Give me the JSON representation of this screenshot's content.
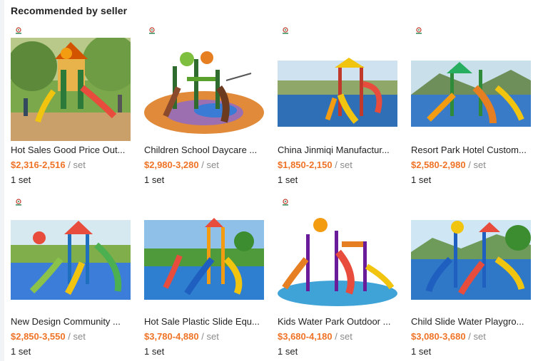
{
  "section": {
    "title": "Recommended by seller"
  },
  "colors": {
    "price": "#ef7326",
    "unit": "#8a8a8a"
  },
  "products": [
    {
      "title": "Hot Sales Good Price Out...",
      "price": "$2,316-2,516",
      "unit": "/ set",
      "moq": "1 set",
      "logo": "supplier-logo-icon",
      "image": "playground-image"
    },
    {
      "title": "Children School Daycare ...",
      "price": "$2,980-3,280",
      "unit": "/ set",
      "moq": "1 set",
      "logo": "supplier-logo-icon",
      "image": "playground-image"
    },
    {
      "title": "China Jinmiqi Manufactur...",
      "price": "$1,850-2,150",
      "unit": "/ set",
      "moq": "1 set",
      "logo": "supplier-logo-icon",
      "image": "playground-image"
    },
    {
      "title": "Resort Park Hotel Custom...",
      "price": "$2,580-2,980",
      "unit": "/ set",
      "moq": "1 set",
      "logo": "supplier-logo-icon",
      "image": "playground-image"
    },
    {
      "title": "New Design Community ...",
      "price": "$2,850-3,550",
      "unit": "/ set",
      "moq": "1 set",
      "logo": "supplier-logo-icon",
      "image": "playground-image"
    },
    {
      "title": "Hot Sale Plastic Slide Equ...",
      "price": "$3,780-4,880",
      "unit": "/ set",
      "moq": "1 set",
      "logo": "supplier-logo-icon",
      "image": "playground-image"
    },
    {
      "title": "Kids Water Park Outdoor ...",
      "price": "$3,680-4,180",
      "unit": "/ set",
      "moq": "1 set",
      "logo": "supplier-logo-icon",
      "image": "water-playground-image"
    },
    {
      "title": "Child Slide Water Playgro...",
      "price": "$3,080-3,680",
      "unit": "/ set",
      "moq": "1 set",
      "logo": "supplier-logo-icon",
      "image": "playground-image"
    }
  ]
}
